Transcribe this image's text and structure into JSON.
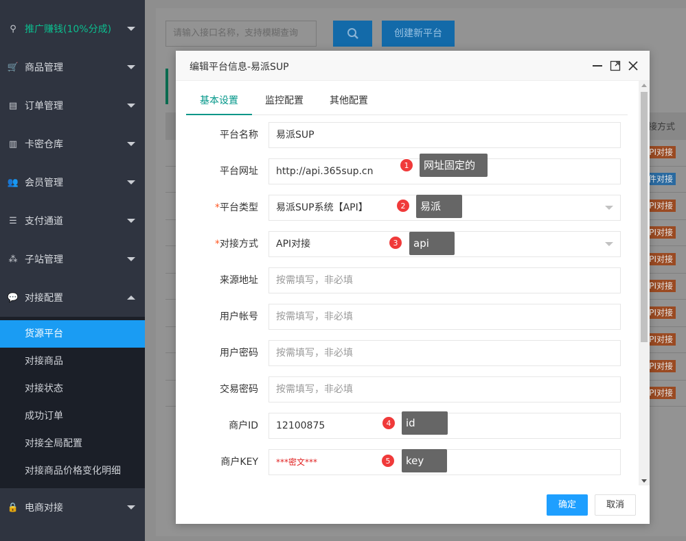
{
  "sidebar": {
    "items": [
      {
        "label": "推广赚钱(10%分成)"
      },
      {
        "label": "商品管理"
      },
      {
        "label": "订单管理"
      },
      {
        "label": "卡密仓库"
      },
      {
        "label": "会员管理"
      },
      {
        "label": "支付通道"
      },
      {
        "label": "子站管理"
      },
      {
        "label": "对接配置"
      },
      {
        "label": "电商对接"
      }
    ],
    "submenu": [
      {
        "label": "货源平台"
      },
      {
        "label": "对接商品"
      },
      {
        "label": "对接状态"
      },
      {
        "label": "成功订单"
      },
      {
        "label": "对接全局配置"
      },
      {
        "label": "对接商品价格变化明细"
      }
    ]
  },
  "toolbar": {
    "search_placeholder": "请输入接口名称，支持模糊查询",
    "create_label": "创建新平台"
  },
  "background_table": {
    "header_text": "接方式",
    "tags": [
      "PI对接",
      "件对接",
      "PI对接",
      "PI对接",
      "PI对接",
      "PI对接",
      "PI对接",
      "PI对接",
      "PI对接",
      "PI对接"
    ]
  },
  "modal": {
    "title": "编辑平台信息-易派SUP",
    "tabs": [
      "基本设置",
      "监控配置",
      "其他配置"
    ],
    "fields": {
      "platform_name": {
        "label": "平台名称",
        "value": "易派SUP"
      },
      "platform_url": {
        "label": "平台网址",
        "value": "http://api.365sup.cn"
      },
      "platform_type": {
        "label": "平台类型",
        "value": "易派SUP系统【API】",
        "required_mark": "*"
      },
      "connect_method": {
        "label": "对接方式",
        "value": "API对接",
        "required_mark": "*"
      },
      "source_addr": {
        "label": "来源地址",
        "placeholder": "按需填写，非必填"
      },
      "user_account": {
        "label": "用户帐号",
        "placeholder": "按需填写，非必填"
      },
      "user_password": {
        "label": "用户密码",
        "placeholder": "按需填写，非必填"
      },
      "trade_password": {
        "label": "交易密码",
        "placeholder": "按需填写，非必填"
      },
      "merchant_id": {
        "label": "商户ID",
        "value": "12100875"
      },
      "merchant_key": {
        "label": "商户KEY",
        "value": "***密文***"
      }
    },
    "ok_label": "确定",
    "cancel_label": "取消"
  },
  "annotations": [
    {
      "num": "1",
      "text": "网址固定的"
    },
    {
      "num": "2",
      "text": "易派"
    },
    {
      "num": "3",
      "text": "api"
    },
    {
      "num": "4",
      "text": "id"
    },
    {
      "num": "5",
      "text": "key"
    }
  ],
  "colors": {
    "sidebar_bg": "#2f3440",
    "active_blue": "#1a9cf3",
    "promo_green": "#0bbf8f",
    "tab_active": "#009688",
    "badge_red": "#f03a3a",
    "ok_button": "#1e9fff"
  }
}
